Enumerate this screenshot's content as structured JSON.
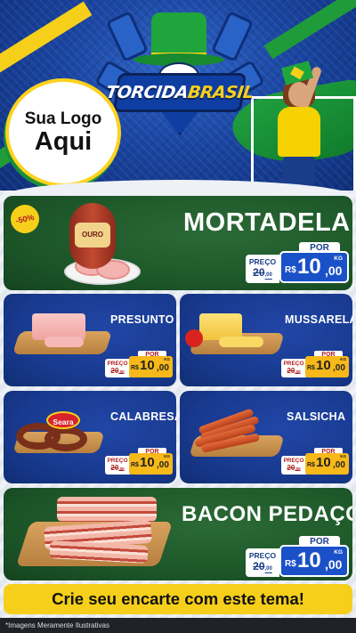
{
  "header": {
    "logo_line1": "Sua Logo",
    "logo_line2": "Aqui",
    "theme_title_part1": "TORCIDA",
    "theme_title_part2": "BRASIL"
  },
  "products": [
    {
      "name": "MORTADELA",
      "discount": "-50%",
      "brand": "OURO",
      "preco_label": "PREÇO",
      "por_label": "POR",
      "old_price": "20",
      "old_cents": ",00",
      "currency": "R$",
      "new_int": "10",
      "new_dec": ",00",
      "unit": "KG"
    },
    {
      "name": "PRESUNTO",
      "preco_label": "PREÇO",
      "por_label": "POR",
      "old_price": "20",
      "old_cents": ",00",
      "currency": "R$",
      "new_int": "10",
      "new_dec": ",00",
      "unit": "KG"
    },
    {
      "name": "MUSSARELA",
      "preco_label": "PREÇO",
      "por_label": "POR",
      "old_price": "20",
      "old_cents": ",00",
      "currency": "R$",
      "new_int": "10",
      "new_dec": ",00",
      "unit": "KG"
    },
    {
      "name": "CALABRESA",
      "brand": "Seara",
      "preco_label": "PREÇO",
      "por_label": "POR",
      "old_price": "20",
      "old_cents": ",00",
      "currency": "R$",
      "new_int": "10",
      "new_dec": ",00",
      "unit": "KG"
    },
    {
      "name": "SALSICHA",
      "preco_label": "PREÇO",
      "por_label": "POR",
      "old_price": "20",
      "old_cents": ",00",
      "currency": "R$",
      "new_int": "10",
      "new_dec": ",00",
      "unit": "KG"
    },
    {
      "name": "BACON PEDAÇO",
      "preco_label": "PREÇO",
      "por_label": "POR",
      "old_price": "20",
      "old_cents": ",00",
      "currency": "R$",
      "new_int": "10",
      "new_dec": ",00",
      "unit": "KG"
    }
  ],
  "cta": "Crie seu encarte com este tema!",
  "disclaimer": "*Imagens Meramente Ilustrativas",
  "colors": {
    "green_panel": "#1d5729",
    "blue_panel": "#183a8f",
    "yellow": "#f6cf1a",
    "price_blue": "#1a51c8",
    "price_orange": "#f7b91a"
  }
}
